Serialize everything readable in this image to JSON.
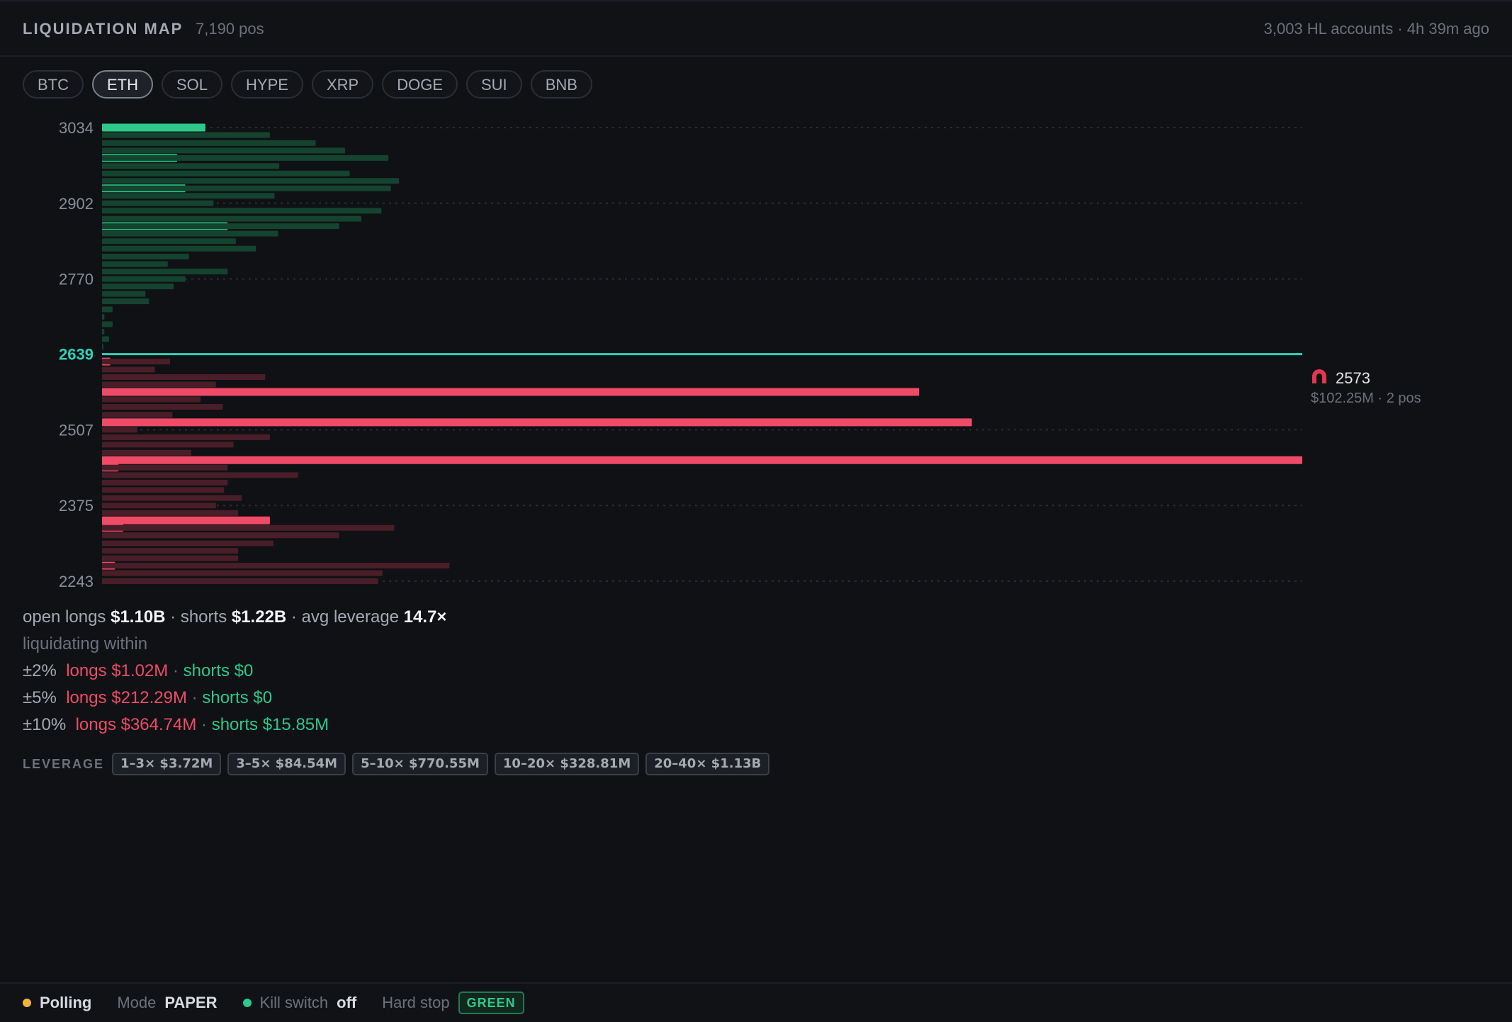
{
  "header": {
    "title": "LIQUIDATION MAP",
    "positions": "7,190 pos",
    "meta": "3,003 HL accounts · 4h 39m ago"
  },
  "tabs": [
    {
      "label": "BTC",
      "active": false
    },
    {
      "label": "ETH",
      "active": true
    },
    {
      "label": "SOL",
      "active": false
    },
    {
      "label": "HYPE",
      "active": false
    },
    {
      "label": "XRP",
      "active": false
    },
    {
      "label": "DOGE",
      "active": false
    },
    {
      "label": "SUI",
      "active": false
    },
    {
      "label": "BNB",
      "active": false
    }
  ],
  "chart_data": {
    "type": "bar",
    "orientation": "horizontal",
    "y_ticks": [
      3034,
      2902,
      2770,
      2639,
      2507,
      2375,
      2243
    ],
    "ylim": [
      2243,
      3034
    ],
    "current_price": 2639,
    "x_max_usd_m": 102.25,
    "callout": {
      "icon": "magnet-icon",
      "price": "2573",
      "detail": "$102.25M · 2 pos"
    },
    "series": [
      {
        "side": "short",
        "color": "#2dc98a",
        "dim_color": "#14432f",
        "bars": [
          {
            "price": 3034,
            "value": 8.8,
            "highlight": true
          },
          {
            "price": 3021,
            "value": 14.3
          },
          {
            "price": 3007,
            "value": 18.2
          },
          {
            "price": 2994,
            "value": 20.7
          },
          {
            "price": 2981,
            "value": 6.4,
            "highlight": true
          },
          {
            "price": 2981,
            "value": 24.4
          },
          {
            "price": 2967,
            "value": 15.1
          },
          {
            "price": 2954,
            "value": 21.1
          },
          {
            "price": 2941,
            "value": 25.3
          },
          {
            "price": 2928,
            "value": 7.1,
            "highlight": true
          },
          {
            "price": 2928,
            "value": 24.6
          },
          {
            "price": 2915,
            "value": 14.7
          },
          {
            "price": 2902,
            "value": 9.5
          },
          {
            "price": 2889,
            "value": 23.8
          },
          {
            "price": 2875,
            "value": 22.1
          },
          {
            "price": 2862,
            "value": 10.7,
            "highlight": true
          },
          {
            "price": 2862,
            "value": 20.2
          },
          {
            "price": 2849,
            "value": 15.0
          },
          {
            "price": 2836,
            "value": 11.4
          },
          {
            "price": 2823,
            "value": 13.1
          },
          {
            "price": 2809,
            "value": 7.4
          },
          {
            "price": 2796,
            "value": 5.6
          },
          {
            "price": 2783,
            "value": 10.7
          },
          {
            "price": 2770,
            "value": 7.1
          },
          {
            "price": 2757,
            "value": 6.1
          },
          {
            "price": 2744,
            "value": 3.7
          },
          {
            "price": 2731,
            "value": 4.0
          },
          {
            "price": 2717,
            "value": 0.9
          },
          {
            "price": 2704,
            "value": 0.2
          },
          {
            "price": 2691,
            "value": 0.9
          },
          {
            "price": 2678,
            "value": 0.2
          },
          {
            "price": 2665,
            "value": 0.6
          },
          {
            "price": 2652,
            "value": 0.1
          }
        ]
      },
      {
        "side": "long",
        "color": "#ef4b67",
        "dim_color": "#4a1e29",
        "bars": [
          {
            "price": 2626,
            "value": 0.7,
            "highlight": true
          },
          {
            "price": 2626,
            "value": 5.8
          },
          {
            "price": 2612,
            "value": 4.5
          },
          {
            "price": 2599,
            "value": 13.9
          },
          {
            "price": 2586,
            "value": 9.7
          },
          {
            "price": 2573,
            "value": 69.6,
            "highlight": true
          },
          {
            "price": 2560,
            "value": 8.4
          },
          {
            "price": 2547,
            "value": 10.3
          },
          {
            "price": 2533,
            "value": 6.0
          },
          {
            "price": 2520,
            "value": 74.1,
            "highlight": true
          },
          {
            "price": 2507,
            "value": 3.0
          },
          {
            "price": 2494,
            "value": 14.3
          },
          {
            "price": 2481,
            "value": 11.2
          },
          {
            "price": 2467,
            "value": 7.6
          },
          {
            "price": 2454,
            "value": 102.25,
            "highlight": true
          },
          {
            "price": 2441,
            "value": 1.4,
            "highlight": true
          },
          {
            "price": 2441,
            "value": 10.7
          },
          {
            "price": 2428,
            "value": 16.7
          },
          {
            "price": 2415,
            "value": 10.7
          },
          {
            "price": 2402,
            "value": 10.4
          },
          {
            "price": 2388,
            "value": 11.9
          },
          {
            "price": 2375,
            "value": 9.7
          },
          {
            "price": 2362,
            "value": 11.6
          },
          {
            "price": 2349,
            "value": 14.3,
            "highlight": true
          },
          {
            "price": 2336,
            "value": 1.8,
            "highlight": true
          },
          {
            "price": 2336,
            "value": 24.9
          },
          {
            "price": 2323,
            "value": 20.2
          },
          {
            "price": 2309,
            "value": 14.6
          },
          {
            "price": 2296,
            "value": 11.6
          },
          {
            "price": 2283,
            "value": 11.6
          },
          {
            "price": 2270,
            "value": 1.1,
            "highlight": true
          },
          {
            "price": 2270,
            "value": 29.6
          },
          {
            "price": 2257,
            "value": 23.9
          },
          {
            "price": 2243,
            "value": 23.5
          }
        ]
      }
    ]
  },
  "stats": {
    "open_label": "open longs",
    "open_longs": "$1.10B",
    "shorts_label": "· shorts",
    "open_shorts": "$1.22B",
    "lev_label": "· avg leverage",
    "avg_leverage": "14.7×",
    "within_label": "liquidating within",
    "ranges": [
      {
        "pct": "±2%",
        "longs": "longs $1.02M",
        "sep": "·",
        "shorts": "shorts $0"
      },
      {
        "pct": "±5%",
        "longs": "longs $212.29M",
        "sep": "·",
        "shorts": "shorts $0"
      },
      {
        "pct": "±10%",
        "longs": "longs $364.74M",
        "sep": "·",
        "shorts": "shorts $15.85M"
      }
    ]
  },
  "leverage": {
    "label": "LEVERAGE",
    "buckets": [
      "1–3× $3.72M",
      "3–5× $84.54M",
      "5–10× $770.55M",
      "10–20× $328.81M",
      "20–40× $1.13B"
    ]
  },
  "footer": {
    "polling_label": "Polling",
    "polling_color": "#f2b33d",
    "mode_label": "Mode",
    "mode_value": "PAPER",
    "kill_color": "#2dc98a",
    "kill_label": "Kill switch",
    "kill_value": "off",
    "hard_stop_label": "Hard stop",
    "hard_stop_value": "GREEN"
  }
}
